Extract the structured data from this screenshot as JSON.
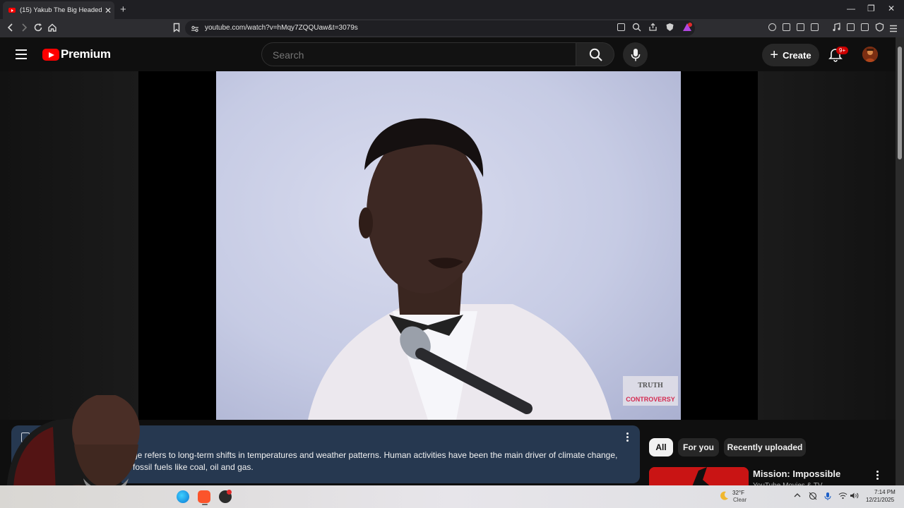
{
  "browser": {
    "tab_title": "(15) Yakub The Big Headed Scie",
    "tab_close": "✕",
    "new_tab": "+",
    "url": "youtube.com/watch?v=hMqy7ZQQUaw&t=3079s",
    "window_controls": {
      "minimize": "—",
      "restore": "❐",
      "close": "✕"
    },
    "nav_icons": [
      "back-icon",
      "forward-icon",
      "reload-icon",
      "home-icon",
      "bookmark-icon"
    ]
  },
  "youtube": {
    "brand": "Premium",
    "search_placeholder": "Search",
    "create_label": "Create",
    "notification_badge": "9+"
  },
  "video": {
    "watermark_line1": "TRUTH",
    "watermark_line2": "CONTROVERSY"
  },
  "description": {
    "text": "ge refers to long-term shifts in temperatures and weather patterns. Human activities have been the main driver of climate change, fossil fuels like coal, oil and gas."
  },
  "chips": [
    "All",
    "For you",
    "Recently uploaded"
  ],
  "recommendation": {
    "title": "Mission: Impossible",
    "subtitle": "YouTube Movies & TV"
  },
  "taskbar": {
    "weather_temp": "32°F",
    "weather_cond": "Clear",
    "time": "7:14 PM",
    "date": "12/21/2025"
  },
  "colors": {
    "yt_red": "#ff0000",
    "description_bg": "#263850",
    "active_chip_bg": "#f1f1f1"
  }
}
